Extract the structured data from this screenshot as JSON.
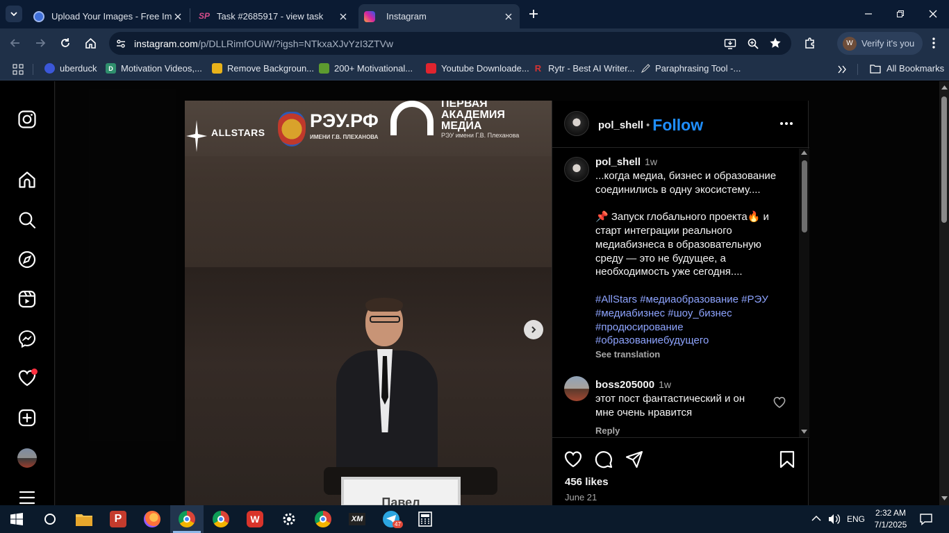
{
  "browser": {
    "tabs": [
      {
        "title": "Upload Your Images - Free Ima",
        "icon": "globe-blue-icon"
      },
      {
        "title": "Task #2685917 - view task",
        "icon": "sp-icon"
      },
      {
        "title": "Instagram",
        "icon": "instagram-icon",
        "active": true
      }
    ],
    "url_host": "instagram.com",
    "url_path": "/p/DLLRimfOUiW/?igsh=NTkxaXJvYzI3ZTVw",
    "verify_label": "Verify it's you",
    "verify_avatar_letter": "W",
    "all_bookmarks": "All Bookmarks"
  },
  "bookmarks": [
    {
      "label": "uberduck",
      "color": "#3b57d8",
      "glyph": ""
    },
    {
      "label": "Motivation Videos,...",
      "color": "#2f8f6d",
      "glyph": "D"
    },
    {
      "label": "Remove Backgroun...",
      "color": "#e8b21a",
      "glyph": ""
    },
    {
      "label": "200+ Motivational...",
      "color": "#5d9b2f",
      "glyph": ""
    },
    {
      "label": "Youtube Downloade...",
      "color": "#e0242e",
      "glyph": ""
    },
    {
      "label": "Rytr - Best AI Writer...",
      "color": "#d23333",
      "glyph": "R"
    },
    {
      "label": "Paraphrasing Tool -...",
      "color": "#cfcfcf",
      "glyph": ""
    }
  ],
  "photo": {
    "logo_allstars": "ALLSTARS",
    "logo_reu": "РЭУ.РФ",
    "logo_reu_sub": "ИМЕНИ Г.В. ПЛЕХАНОВА",
    "logo_academy_1": "ПЕРВАЯ",
    "logo_academy_2": "АКАДЕМИЯ",
    "logo_academy_3": "МЕДИА",
    "logo_academy_sub": "РЭУ имени Г.В. Плеханова",
    "nameplate": "Павел"
  },
  "post": {
    "author": "pol_shell",
    "follow_label": "Follow",
    "caption_time": "1w",
    "caption_lines": [
      "...когда медиа, бизнес и образование соединились в одну экосистему....",
      "📌 Запуск глобального проекта🔥 и старт интеграции реального медиабизнеса в образовательную среду — это не будущее, а необходимость уже сегодня...."
    ],
    "hashtags": "#AllStars #медиаобразование #РЭУ #медиабизнес #шоу_бизнес #продюсирование #образованиебудущего",
    "see_translation": "See translation",
    "comments": [
      {
        "user": "boss205000",
        "time": "1w",
        "text": "этот пост фантастический и он мне очень нравится",
        "reply": "Reply"
      }
    ],
    "likes": "456 likes",
    "date": "June 21"
  },
  "taskbar": {
    "lang": "ENG",
    "time": "2:32 AM",
    "date": "7/1/2025",
    "telegram_badge": "47"
  }
}
